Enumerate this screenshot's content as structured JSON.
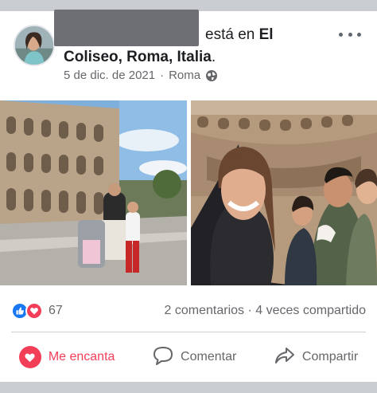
{
  "post": {
    "header": {
      "line1_suffix": "está en",
      "line1_place_start": "El",
      "location": "Coliseo, Roma, Italia",
      "period": "."
    },
    "date": "5 de dic. de 2021",
    "separator": "·",
    "place": "Roma",
    "icons": {
      "privacy": "globe-icon",
      "more": "more-options-icon"
    }
  },
  "stats": {
    "reaction_count": "67",
    "comments": "2 comentarios",
    "dot": "·",
    "shares": "4 veces compartido"
  },
  "actions": {
    "love_label": "Me encanta",
    "comment_label": "Comentar",
    "share_label": "Compartir"
  },
  "colors": {
    "love": "#f33e58",
    "like": "#1877f2",
    "meta_gray": "#65676b"
  }
}
